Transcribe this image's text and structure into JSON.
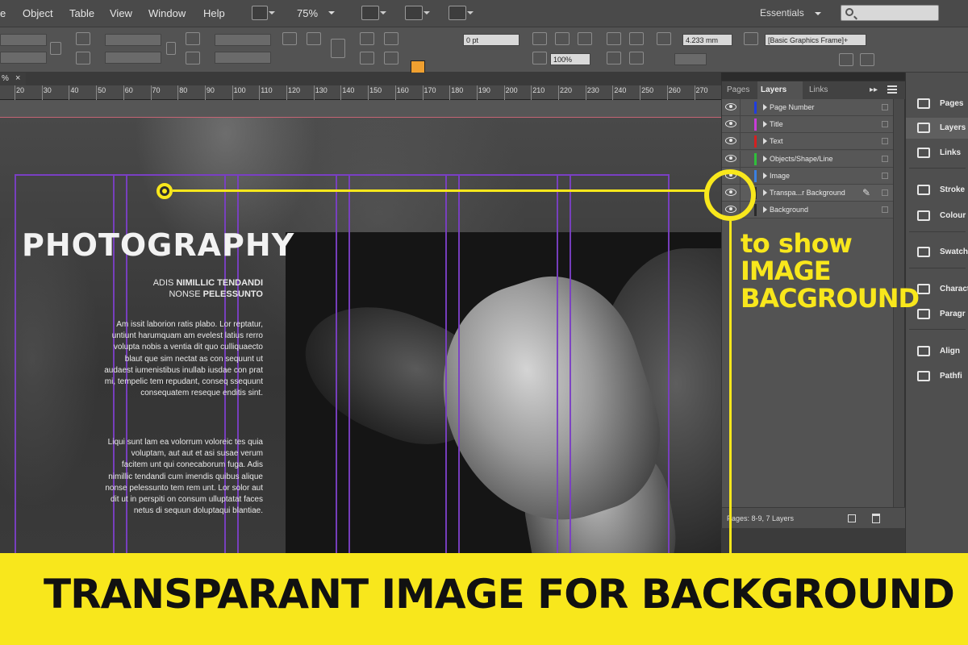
{
  "menu": {
    "items": [
      "e",
      "Object",
      "Table",
      "View",
      "Window",
      "Help"
    ],
    "zoom": "75%",
    "workspace": "Essentials"
  },
  "controls": {
    "stroke_weight": "0 pt",
    "opacity": "100%",
    "dimension": "4.233 mm",
    "object_style": "[Basic Graphics Frame]+"
  },
  "document_tab": {
    "label": "%",
    "close": "×"
  },
  "ruler": {
    "labels": [
      "20",
      "30",
      "40",
      "50",
      "60",
      "70",
      "80",
      "90",
      "100",
      "110",
      "120",
      "130",
      "140",
      "150",
      "160",
      "170",
      "180",
      "190",
      "200",
      "210",
      "220",
      "230",
      "240",
      "250",
      "260",
      "270"
    ]
  },
  "document": {
    "heading": "PHOTOGRAPHY",
    "subhead_line1_normal": "ADIS ",
    "subhead_line1_bold": "NIMILLIC TENDANDI",
    "subhead_line2_normal": "NONSE ",
    "subhead_line2_bold": "PELESSUNTO",
    "para1": "Am issit laborion ratis plabo. Lor reptatur, untiunt harumquam am evelest latius rerro volupta nobis a ventia dit quo culliquaecto blaut que sim nectat as con sequunt ut audaest iumenistibus inullab iusdae con prat mi, tempelic tem repudant, conseq ssequunt consequatem reseque enditis sint.",
    "para2": "Liqui sunt lam ea volorrum voloreic tes quia voluptam, aut aut et asi susae verum facitem unt qui conecaborum fuga. Adis nimillic tendandi cum imendis quibus alique nonse pelessunto tem rem unt. Lor solor aut dit ut in perspiti on consum ulluptatat faces netus di sequun doluptaqui blantiae."
  },
  "callout": {
    "line1": "to show",
    "line2": "IMAGE",
    "line3": "BACGROUND",
    "color": "#f8e71c"
  },
  "layers_panel": {
    "tabs": [
      "Pages",
      "Layers",
      "Links"
    ],
    "layers": [
      {
        "name": "Page Number",
        "color": "#1f3de0"
      },
      {
        "name": "Title",
        "color": "#c83cd8"
      },
      {
        "name": "Text",
        "color": "#d42020"
      },
      {
        "name": "Objects/Shape/Line",
        "color": "#2fbf3a"
      },
      {
        "name": "Image",
        "color": "#3a80e0"
      },
      {
        "name": "Transpa...r Background",
        "color": "#2a2a2a"
      },
      {
        "name": "Background",
        "color": "#2a2a2a"
      }
    ],
    "status": "Pages: 8-9, 7 Layers"
  },
  "dock": {
    "items": [
      "Pages",
      "Layers",
      "Links",
      "Stroke",
      "Colour",
      "Swatch",
      "Charact",
      "Paragr",
      "Align",
      "Pathfi"
    ]
  },
  "banner": {
    "text": "TRANSPARANT IMAGE FOR BACKGROUND",
    "color": "#f8e71c"
  }
}
